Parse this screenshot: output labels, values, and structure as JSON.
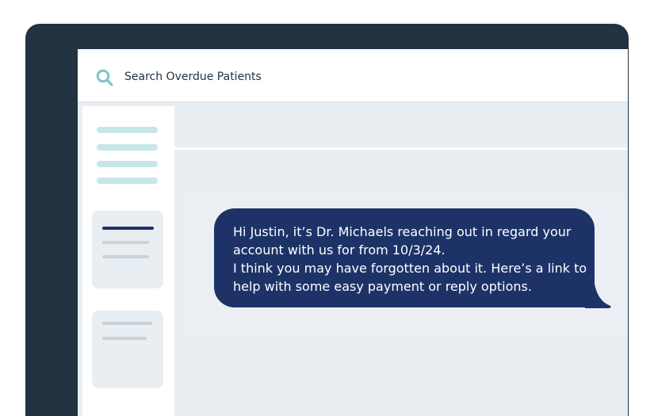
{
  "search": {
    "label": "Search Overdue Patients",
    "icon": "search-icon",
    "icon_color": "#7fc4c7"
  },
  "message": {
    "lines": [
      "Hi Justin, it’s Dr. Michaels reaching out in regard your",
      "account with us for from 10/3/24.",
      "I think you may have forgotten about it. Here’s a link to",
      "help with some easy payment or reply options."
    ],
    "bubble_color": "#1d3368",
    "text_color": "#ffffff"
  },
  "colors": {
    "frame": "#223240",
    "screen_bg": "#e9eef2",
    "nav_accent": "#c7e6e8"
  }
}
